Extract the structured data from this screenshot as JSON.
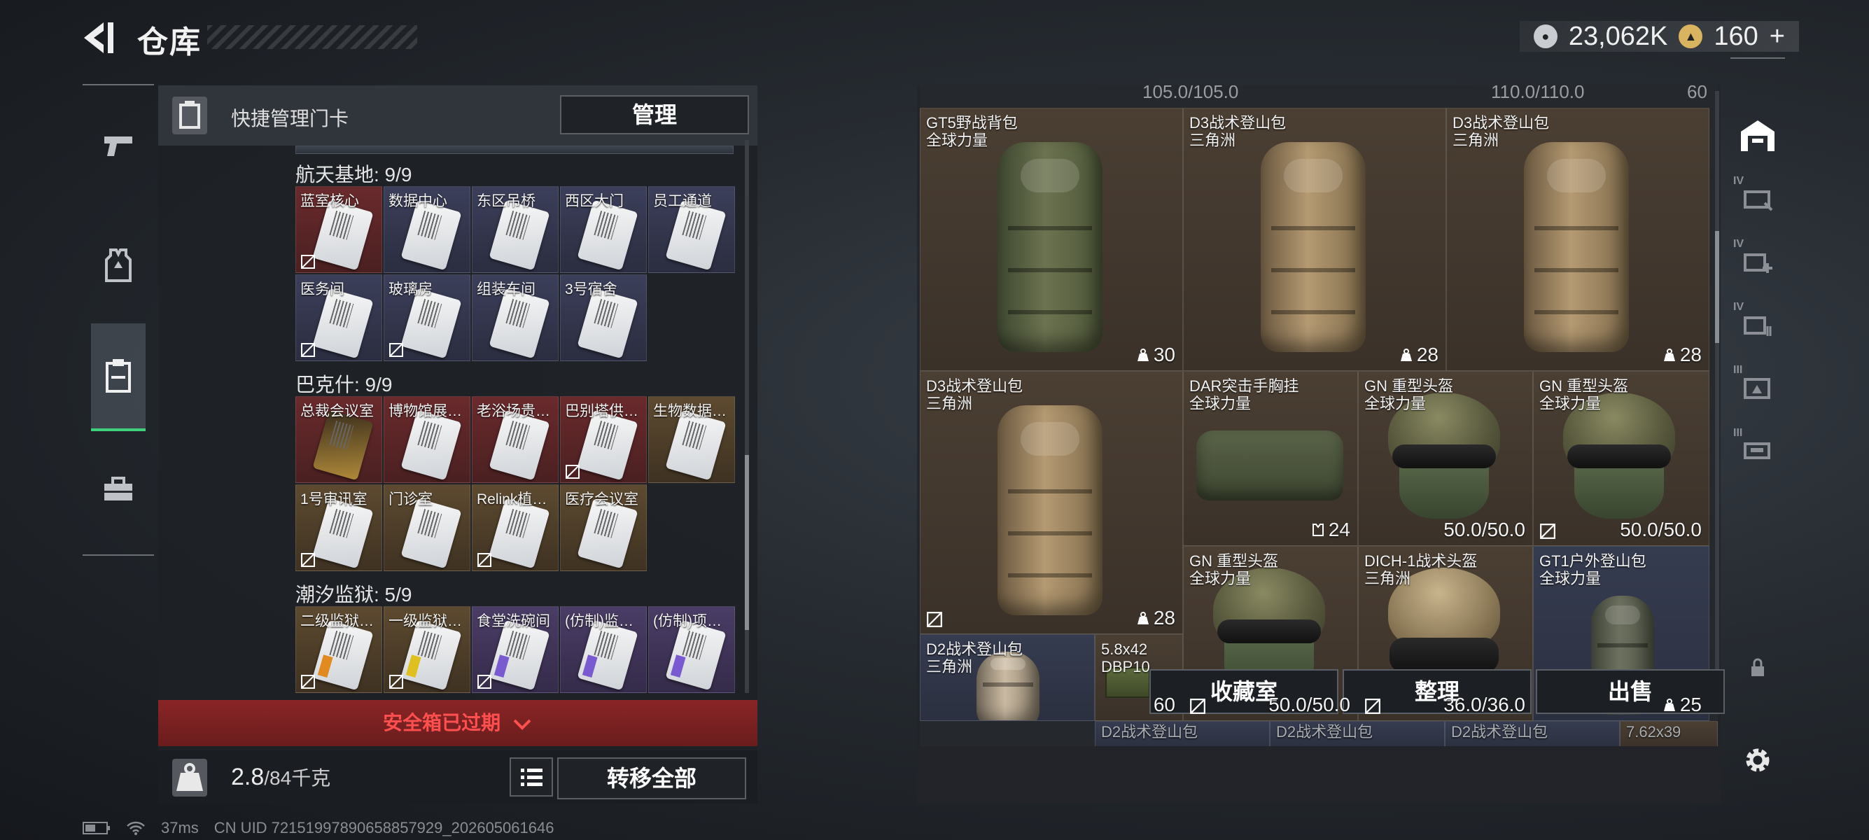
{
  "header": {
    "title": "仓库",
    "currency1": "23,062K",
    "currency2": "160",
    "currency2_plus": "+"
  },
  "keycards": {
    "header_title": "快捷管理门卡",
    "manage_label": "管理",
    "sections": [
      {
        "title": "航天基地: 9/9",
        "cards": [
          {
            "name": "蓝室核心",
            "color": "red",
            "nosell": true
          },
          {
            "name": "数据中心",
            "color": "blue",
            "nosell": false
          },
          {
            "name": "东区吊桥",
            "color": "blue",
            "nosell": false
          },
          {
            "name": "西区大门",
            "color": "blue",
            "nosell": false
          },
          {
            "name": "员工通道",
            "color": "blue",
            "nosell": false
          },
          {
            "name": "医务间",
            "color": "blue",
            "nosell": true
          },
          {
            "name": "玻璃房",
            "color": "blue",
            "nosell": true
          },
          {
            "name": "组装车间",
            "color": "blue",
            "nosell": false
          },
          {
            "name": "3号宿舍",
            "color": "blue",
            "nosell": false
          }
        ]
      },
      {
        "title": "巴克什: 9/9",
        "cards": [
          {
            "name": "总裁会议室",
            "color": "red",
            "nosell": false,
            "gold": true
          },
          {
            "name": "博物馆展…",
            "color": "red",
            "nosell": false
          },
          {
            "name": "老浴场贵…",
            "color": "red",
            "nosell": false
          },
          {
            "name": "巴别塔供…",
            "color": "red",
            "nosell": true
          },
          {
            "name": "生物数据…",
            "color": "gold",
            "nosell": false
          },
          {
            "name": "1号审讯室",
            "color": "gold",
            "nosell": true
          },
          {
            "name": "门诊室",
            "color": "gold",
            "nosell": false
          },
          {
            "name": "Relink植…",
            "color": "gold",
            "nosell": true
          },
          {
            "name": "医疗会议室",
            "color": "gold",
            "nosell": false
          }
        ]
      },
      {
        "title": "潮汐监狱: 5/9",
        "cards": [
          {
            "name": "二级监狱…",
            "color": "gold",
            "nosell": true,
            "stripe": "o"
          },
          {
            "name": "一级监狱…",
            "color": "gold",
            "nosell": true,
            "stripe": "y"
          },
          {
            "name": "食堂洗碗间",
            "color": "purple",
            "nosell": true,
            "stripe": "p"
          },
          {
            "name": "(仿制)监…",
            "color": "purple",
            "nosell": false,
            "stripe": "p"
          },
          {
            "name": "(仿制)项…",
            "color": "purple",
            "nosell": false,
            "stripe": "p"
          }
        ]
      }
    ],
    "expired": "安全箱已过期",
    "weight_current": "2.8",
    "weight_total": "/84千克",
    "transfer_label": "转移全部"
  },
  "stash": {
    "top_numbers": [
      "105.0/105.0",
      "110.0/110.0",
      "60"
    ],
    "items": [
      {
        "name": "GT5野战背包",
        "origin": "全球力量",
        "value": "30"
      },
      {
        "name": "D3战术登山包",
        "origin": "三角洲",
        "value": "28"
      },
      {
        "name": "D3战术登山包",
        "origin": "三角洲",
        "value": "28"
      },
      {
        "name": "D3战术登山包",
        "origin": "三角洲",
        "value": "28"
      },
      {
        "name": "DAR突击手胸挂",
        "origin": "全球力量",
        "value": "24"
      },
      {
        "name": "GN 重型头盔",
        "origin": "全球力量",
        "value": "50.0/50.0"
      },
      {
        "name": "GN 重型头盔",
        "origin": "全球力量",
        "value": "50.0/50.0"
      },
      {
        "name": "GN 重型头盔",
        "origin": "全球力量",
        "value": "50.0/50.0"
      },
      {
        "name": "DICH-1战术头盔",
        "origin": "三角洲",
        "value": "36.0/36.0"
      },
      {
        "name": "GT1户外登山包",
        "origin": "全球力量",
        "value": "25"
      },
      {
        "name": "D2战术登山包",
        "origin": "三角洲",
        "value": ""
      },
      {
        "name": "5.8x42",
        "origin": "DBP10",
        "value": "60"
      }
    ],
    "bottom_partial": [
      "D2战术登山包",
      "D2战术登山包",
      "D2战术登山包",
      "7.62x39"
    ],
    "buttons": {
      "collection": "收藏室",
      "sort": "整理",
      "sell": "出售"
    }
  },
  "rightnav": {
    "levels": [
      "IV",
      "IV",
      "IV",
      "III",
      "III"
    ]
  },
  "status": {
    "ping": "37ms",
    "uid": "CN UID 72151997890658857929_202605061646"
  }
}
